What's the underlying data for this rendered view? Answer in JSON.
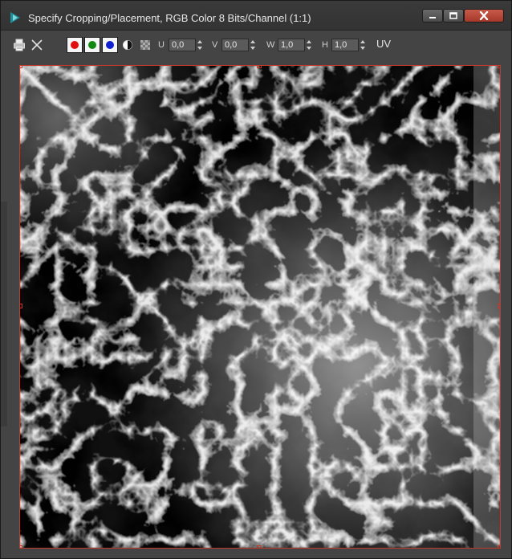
{
  "window": {
    "title": "Specify Cropping/Placement, RGB Color 8 Bits/Channel (1:1)"
  },
  "titlebar_buttons": [
    "minimize-icon",
    "maximize-icon",
    "close-icon"
  ],
  "toolbar": {
    "icons": [
      "print-icon",
      "close-x-icon"
    ],
    "channels": [
      {
        "name": "red-channel",
        "color": "#e01010"
      },
      {
        "name": "green-channel",
        "color": "#108a10"
      },
      {
        "name": "blue-channel",
        "color": "#1020d0"
      }
    ],
    "extra_icons": [
      "mono-toggle-icon",
      "alpha-checker-icon"
    ],
    "fields": [
      {
        "label": "U",
        "value": "0,0"
      },
      {
        "label": "V",
        "value": "0,0"
      },
      {
        "label": "W",
        "value": "1,0"
      },
      {
        "label": "H",
        "value": "1,0"
      }
    ],
    "uv_label": "UV"
  },
  "colors": {
    "frame_border": "#c43a2a",
    "window_bg": "#444444"
  }
}
